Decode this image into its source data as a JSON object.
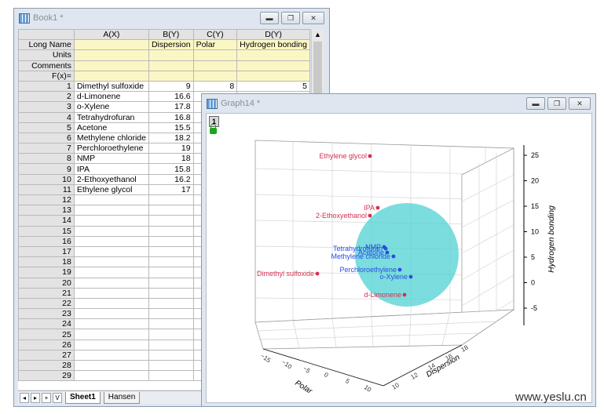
{
  "book": {
    "title": "Book1 *",
    "columns": [
      {
        "header": "A(X)",
        "long_name": ""
      },
      {
        "header": "B(Y)",
        "long_name": "Dispersion"
      },
      {
        "header": "C(Y)",
        "long_name": "Polar"
      },
      {
        "header": "D(Y)",
        "long_name": "Hydrogen bonding"
      }
    ],
    "meta_rows": [
      "Long Name",
      "Units",
      "Comments",
      "F(x)="
    ],
    "rows": [
      {
        "n": "1",
        "a": "Dimethyl sulfoxide",
        "b": "9",
        "c": "8",
        "d": "5"
      },
      {
        "n": "2",
        "a": "d-Limonene",
        "b": "16.6",
        "c": "",
        "d": ""
      },
      {
        "n": "3",
        "a": "o-Xylene",
        "b": "17.8",
        "c": "",
        "d": ""
      },
      {
        "n": "4",
        "a": "Tetrahydrofuran",
        "b": "16.8",
        "c": "",
        "d": ""
      },
      {
        "n": "5",
        "a": "Acetone",
        "b": "15.5",
        "c": "",
        "d": ""
      },
      {
        "n": "6",
        "a": "Methylene chloride",
        "b": "18.2",
        "c": "",
        "d": ""
      },
      {
        "n": "7",
        "a": "Perchloroethylene",
        "b": "19",
        "c": "",
        "d": ""
      },
      {
        "n": "8",
        "a": "NMP",
        "b": "18",
        "c": "",
        "d": ""
      },
      {
        "n": "9",
        "a": "IPA",
        "b": "15.8",
        "c": "",
        "d": ""
      },
      {
        "n": "10",
        "a": "2-Ethoxyethanol",
        "b": "16.2",
        "c": "",
        "d": ""
      },
      {
        "n": "11",
        "a": "Ethylene glycol",
        "b": "17",
        "c": "",
        "d": ""
      },
      {
        "n": "12"
      },
      {
        "n": "13"
      },
      {
        "n": "14"
      },
      {
        "n": "15"
      },
      {
        "n": "16"
      },
      {
        "n": "17"
      },
      {
        "n": "18"
      },
      {
        "n": "19"
      },
      {
        "n": "20"
      },
      {
        "n": "21"
      },
      {
        "n": "22"
      },
      {
        "n": "23"
      },
      {
        "n": "24"
      },
      {
        "n": "25"
      },
      {
        "n": "26"
      },
      {
        "n": "27"
      },
      {
        "n": "28"
      },
      {
        "n": "29"
      }
    ],
    "sheet_tabs": [
      "Sheet1",
      "Hansen"
    ],
    "nav_buttons": [
      "◂",
      "▸",
      "+",
      "V"
    ]
  },
  "graph": {
    "title": "Graph14 *",
    "layer_number": "1",
    "y_axis_label": "Hydrogen bonding",
    "x_axis_label": "Dispersion",
    "z_axis_label": "Polar",
    "y_ticks": [
      "-5",
      "0",
      "5",
      "10",
      "15",
      "20",
      "25"
    ],
    "points": [
      {
        "label": "Ethylene glycol",
        "color": "#d62f4f"
      },
      {
        "label": "IPA",
        "color": "#d62f4f"
      },
      {
        "label": "2-Ethoxyethanol",
        "color": "#d62f4f"
      },
      {
        "label": "NMP",
        "color": "#2a4de0"
      },
      {
        "label": "Tetrahydrofuran",
        "color": "#2a4de0"
      },
      {
        "label": "Acetone",
        "color": "#2a4de0"
      },
      {
        "label": "Methylene chloride",
        "color": "#2a4de0"
      },
      {
        "label": "Perchloroethylene",
        "color": "#2a4de0"
      },
      {
        "label": "o-Xylene",
        "color": "#2a4de0"
      },
      {
        "label": "d-Limonene",
        "color": "#d62f4f"
      },
      {
        "label": "Dimethyl sulfoxide",
        "color": "#d62f4f"
      }
    ],
    "sphere_color": "#4fd1d3"
  },
  "watermark": "www.yeslu.cn"
}
